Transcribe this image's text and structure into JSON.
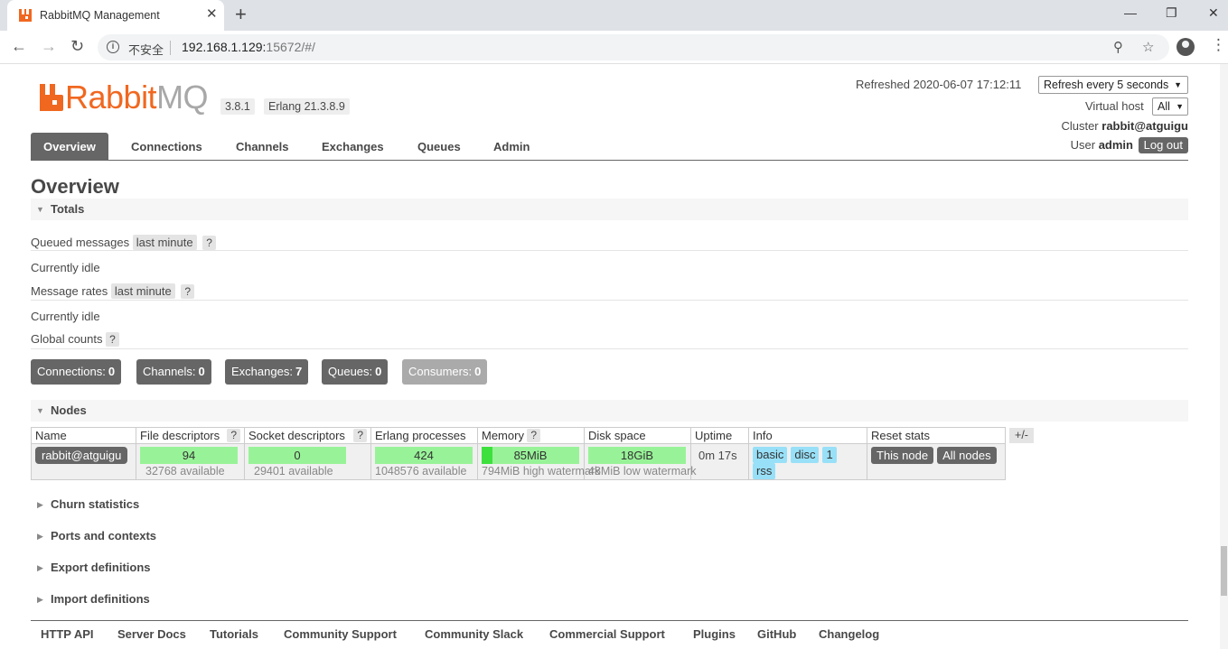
{
  "browser": {
    "tab_title": "RabbitMQ Management",
    "close_glyph": "✕",
    "new_tab_glyph": "+",
    "insecure_label": "不安全",
    "url_host": "192.168.1.129:",
    "url_path": "15672/#/"
  },
  "header": {
    "logo_rabbit": "Rabbit",
    "logo_mq": "MQ",
    "version": "3.8.1",
    "erlang": "Erlang 21.3.8.9",
    "refreshed": "Refreshed 2020-06-07 17:12:11",
    "refresh_option": "Refresh every 5 seconds",
    "vhost_label": "Virtual host",
    "vhost_value": "All",
    "cluster_label": "Cluster",
    "cluster_value": "rabbit@atguigu",
    "user_label": "User",
    "user_value": "admin",
    "logout_label": "Log out"
  },
  "nav": {
    "overview": "Overview",
    "connections": "Connections",
    "channels": "Channels",
    "exchanges": "Exchanges",
    "queues": "Queues",
    "admin": "Admin"
  },
  "page_title": "Overview",
  "totals": {
    "title": "Totals",
    "queued_label": "Queued messages",
    "queued_period": "last minute",
    "help": "?",
    "queued_status": "Currently idle",
    "rates_label": "Message rates",
    "rates_period": "last minute",
    "rates_status": "Currently idle",
    "global_label": "Global counts",
    "counts": {
      "connections_label": "Connections:",
      "connections": "0",
      "channels_label": "Channels:",
      "channels": "0",
      "exchanges_label": "Exchanges:",
      "exchanges": "7",
      "queues_label": "Queues:",
      "queues": "0",
      "consumers_label": "Consumers:",
      "consumers": "0"
    }
  },
  "nodes": {
    "title": "Nodes",
    "columns": [
      "Name",
      "File descriptors",
      "Socket descriptors",
      "Erlang processes",
      "Memory",
      "Disk space",
      "Uptime",
      "Info",
      "Reset stats"
    ],
    "plus_minus": "+/-",
    "row": {
      "name": "rabbit@atguigu",
      "fd": "94",
      "fd_avail": "32768 available",
      "sockets": "0",
      "sockets_avail": "29401 available",
      "procs": "424",
      "procs_avail": "1048576 available",
      "memory": "85MiB",
      "memory_fraction": 0.107,
      "memory_note": "794MiB high watermark",
      "disk": "18GiB",
      "disk_note": "48MiB low watermark",
      "uptime": "0m 17s",
      "info_tags": [
        "basic",
        "disc",
        "1",
        "rss"
      ],
      "reset_this": "This node",
      "reset_all": "All nodes"
    }
  },
  "sections": {
    "churn": "Churn statistics",
    "ports": "Ports and contexts",
    "export": "Export definitions",
    "import": "Import definitions"
  },
  "footer": {
    "links": [
      "HTTP API",
      "Server Docs",
      "Tutorials",
      "Community Support",
      "Community Slack",
      "Commercial Support",
      "Plugins",
      "GitHub",
      "Changelog"
    ]
  },
  "colors": {
    "brand_orange": "#f06820",
    "nav_active": "#666666",
    "bar_green": "#98f398",
    "info_blue": "#98e0f8"
  }
}
